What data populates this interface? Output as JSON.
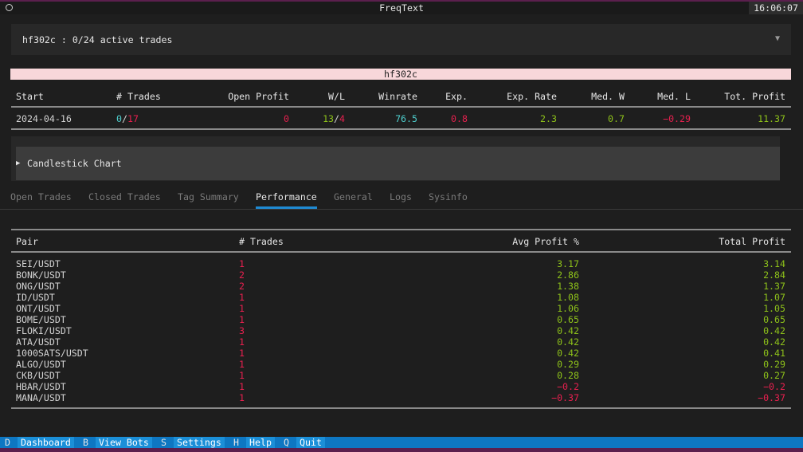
{
  "window": {
    "title": "FreqText",
    "clock": "16:06:07"
  },
  "bot_select": {
    "label": "hf302c : 0/24 active trades"
  },
  "bot_banner": "hf302c",
  "summary": {
    "headers": [
      "Start",
      "# Trades",
      "Open Profit",
      "W/L",
      "Winrate",
      "Exp.",
      "Exp. Rate",
      "Med. W",
      "Med. L",
      "Tot. Profit"
    ],
    "row": {
      "start": "2024-04-16",
      "trades_open": "0",
      "trades_sep": "/",
      "trades_total": "17",
      "open_profit": "0",
      "wins": "13",
      "wl_sep": "/",
      "losses": "4",
      "winrate": "76.5",
      "exp": "0.8",
      "exp_rate": "2.3",
      "med_w": "0.7",
      "med_l": "−0.29",
      "tot_profit": "11.37"
    }
  },
  "candlestick": {
    "label": "Candlestick Chart"
  },
  "tabs": [
    "Open Trades",
    "Closed Trades",
    "Tag Summary",
    "Performance",
    "General",
    "Logs",
    "Sysinfo"
  ],
  "active_tab": "Performance",
  "performance": {
    "headers": [
      "Pair",
      "# Trades",
      "Avg Profit %",
      "Total Profit"
    ],
    "rows": [
      [
        "SEI/USDT",
        "1",
        "3.17",
        "3.14"
      ],
      [
        "BONK/USDT",
        "2",
        "2.86",
        "2.84"
      ],
      [
        "ONG/USDT",
        "2",
        "1.38",
        "1.37"
      ],
      [
        "ID/USDT",
        "1",
        "1.08",
        "1.07"
      ],
      [
        "ONT/USDT",
        "1",
        "1.06",
        "1.05"
      ],
      [
        "BOME/USDT",
        "1",
        "0.65",
        "0.65"
      ],
      [
        "FLOKI/USDT",
        "3",
        "0.42",
        "0.42"
      ],
      [
        "ATA/USDT",
        "1",
        "0.42",
        "0.42"
      ],
      [
        "1000SATS/USDT",
        "1",
        "0.42",
        "0.41"
      ],
      [
        "ALGO/USDT",
        "1",
        "0.29",
        "0.29"
      ],
      [
        "CKB/USDT",
        "1",
        "0.28",
        "0.27"
      ],
      [
        "HBAR/USDT",
        "1",
        "−0.2",
        "−0.2"
      ],
      [
        "MANA/USDT",
        "1",
        "−0.37",
        "−0.37"
      ]
    ]
  },
  "footer": {
    "items": [
      {
        "key": "D",
        "label": "Dashboard"
      },
      {
        "key": "B",
        "label": "View Bots"
      },
      {
        "key": "S",
        "label": "Settings"
      },
      {
        "key": "H",
        "label": "Help"
      },
      {
        "key": "Q",
        "label": "Quit"
      }
    ]
  },
  "colors": {
    "positive": "#8ec21a",
    "negative": "#e8204f",
    "accent": "#1f8ad2",
    "footer_bg": "#0e77c2"
  }
}
